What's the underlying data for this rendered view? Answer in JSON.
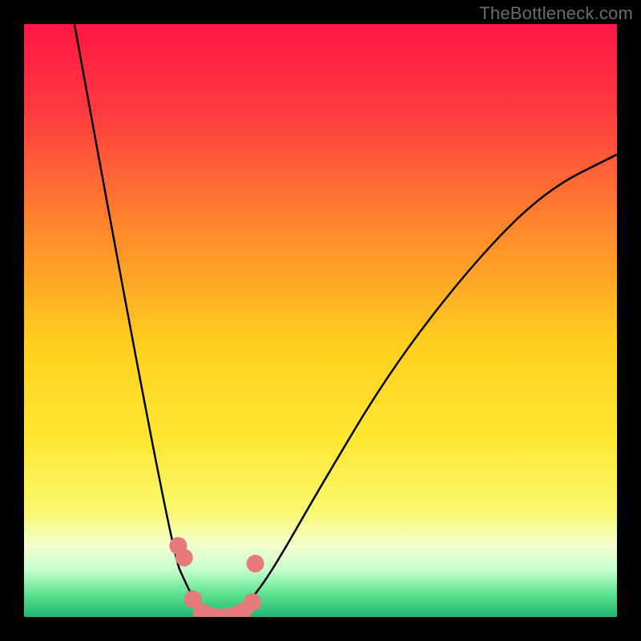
{
  "watermark": "TheBottleneck.com",
  "chart_data": {
    "type": "line",
    "title": "",
    "xlabel": "",
    "ylabel": "",
    "xlim": [
      0,
      1
    ],
    "ylim": [
      0,
      100
    ],
    "gradient_stops": [
      {
        "offset": 0.0,
        "color": "#ff1744"
      },
      {
        "offset": 0.15,
        "color": "#ff3b3f"
      },
      {
        "offset": 0.35,
        "color": "#ff8a2b"
      },
      {
        "offset": 0.55,
        "color": "#ffd21f"
      },
      {
        "offset": 0.7,
        "color": "#ffe733"
      },
      {
        "offset": 0.82,
        "color": "#faf96e"
      },
      {
        "offset": 0.88,
        "color": "#f4ffcf"
      },
      {
        "offset": 0.92,
        "color": "#c8ffcf"
      },
      {
        "offset": 0.96,
        "color": "#5fe38f"
      },
      {
        "offset": 1.0,
        "color": "#1eb873"
      }
    ],
    "series": [
      {
        "name": "left-arm",
        "x": [
          0.085,
          0.245,
          0.28,
          0.3,
          0.32,
          0.34
        ],
        "y": [
          100,
          12,
          4,
          1,
          0,
          0
        ]
      },
      {
        "name": "right-arm",
        "x": [
          0.34,
          0.36,
          0.38,
          0.42,
          0.5,
          0.62,
          0.76,
          0.88,
          1.0
        ],
        "y": [
          0,
          0.5,
          2.5,
          8,
          22,
          42,
          60,
          72,
          78
        ]
      }
    ],
    "markers": {
      "comment": "salmon/coral dots along the valley floor",
      "color": "#e77a7a",
      "radius_px": 11,
      "points": [
        {
          "x": 0.26,
          "y": 12
        },
        {
          "x": 0.27,
          "y": 10
        },
        {
          "x": 0.285,
          "y": 3
        },
        {
          "x": 0.3,
          "y": 0.8
        },
        {
          "x": 0.31,
          "y": 0.3
        },
        {
          "x": 0.325,
          "y": 0
        },
        {
          "x": 0.34,
          "y": 0
        },
        {
          "x": 0.355,
          "y": 0.3
        },
        {
          "x": 0.37,
          "y": 1
        },
        {
          "x": 0.385,
          "y": 2.5
        },
        {
          "x": 0.39,
          "y": 9
        }
      ]
    }
  }
}
